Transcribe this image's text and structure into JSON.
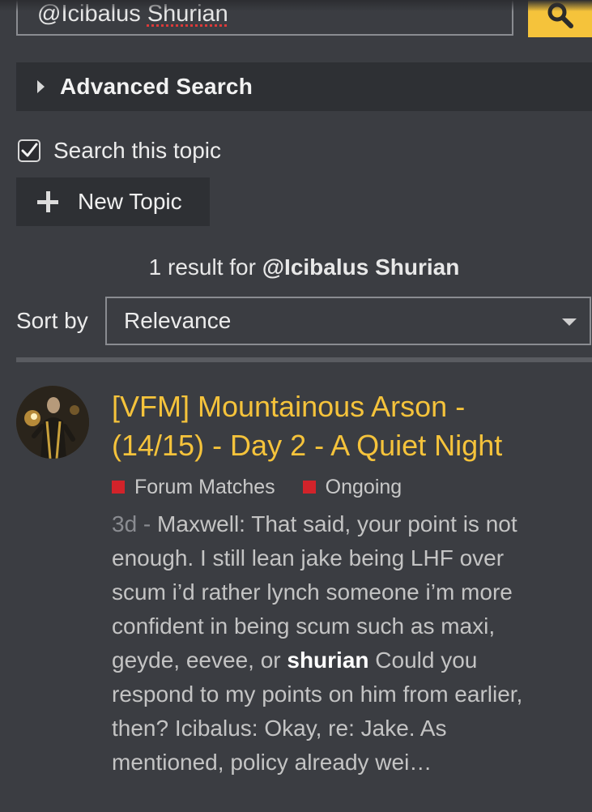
{
  "search": {
    "value_prefix": "@Icibalus ",
    "value_misspelled": "Shurian"
  },
  "advanced_search": {
    "label": "Advanced Search"
  },
  "search_topic": {
    "label": "Search this topic",
    "checked": true
  },
  "new_topic": {
    "label": "New Topic"
  },
  "results_summary": {
    "prefix": "1 result for ",
    "term": "@Icibalus Shurian"
  },
  "sort": {
    "label": "Sort by",
    "selected": "Relevance"
  },
  "results": [
    {
      "title": "[VFM] Mountainous Arson - (14/15) - Day 2 - A Quiet Night",
      "tags": [
        {
          "label": "Forum Matches",
          "color": "#d2232a"
        },
        {
          "label": "Ongoing",
          "color": "#d2232a"
        }
      ],
      "date": "3d",
      "separator": " - ",
      "blurb_before": "Maxwell: That said, your point is not enough. I still lean jake being LHF over scum i’d rather lynch someone i’m more confident in being scum such as maxi, geyde, eevee, or ",
      "blurb_highlight": "shurian",
      "blurb_after": " Could you respond to my points on him from earlier, then? Icibalus: Okay, re: Jake. As mentioned, policy already wei…"
    }
  ],
  "colors": {
    "accent": "#f5c33b",
    "background": "#3b3d42",
    "panel": "#2e3034",
    "tag": "#d2232a"
  }
}
